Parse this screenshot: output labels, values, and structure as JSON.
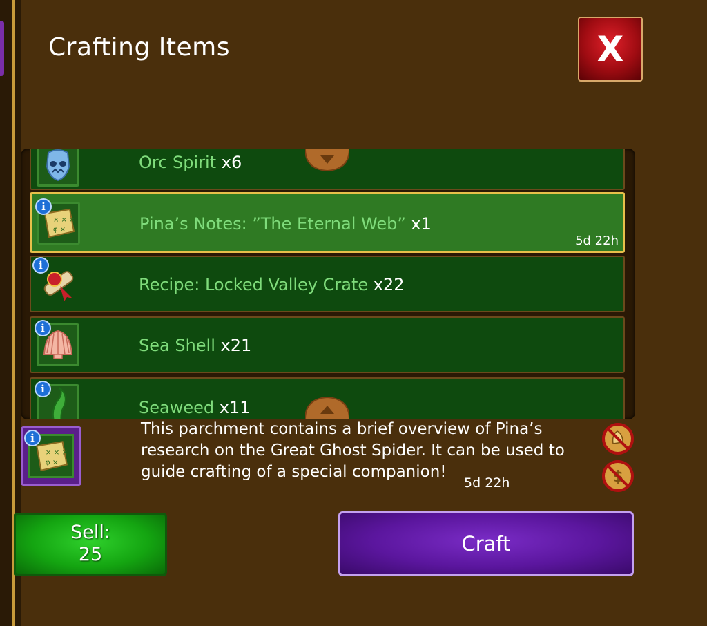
{
  "window": {
    "title": "Crafting Items",
    "close_label": "X"
  },
  "items": [
    {
      "name": "Orc Spirit",
      "qty": "x6",
      "timer": "",
      "icon": "orc-spirit-icon",
      "info": false
    },
    {
      "name": "Pina’s Notes: ”The Eternal Web”",
      "qty": "x1",
      "timer": "5d 22h",
      "icon": "scroll-notes-icon",
      "info": true,
      "selected": true
    },
    {
      "name": "Recipe: Locked Valley Crate",
      "qty": "x22",
      "timer": "",
      "icon": "recipe-scroll-icon",
      "info": true
    },
    {
      "name": "Sea Shell",
      "qty": "x21",
      "timer": "",
      "icon": "sea-shell-icon",
      "info": true
    },
    {
      "name": "Seaweed",
      "qty": "x11",
      "timer": "",
      "icon": "seaweed-icon",
      "info": true
    }
  ],
  "details": {
    "description": "This parchment contains a brief overview of Pina’s research on the Great Ghost Spider. It can be used to guide crafting of a special companion!",
    "timer": "5d 22h",
    "info_label": "i"
  },
  "actions": {
    "sell_label": "Sell:",
    "sell_price": "25",
    "craft_label": "Craft"
  },
  "colors": {
    "background": "#4a2f0c",
    "row": "#0e4a0e",
    "row_selected": "#2f7a23",
    "item_name": "#7fdc7b",
    "sell_button": "#14a511",
    "craft_button": "#5b169e",
    "close_button": "#c0141c"
  }
}
